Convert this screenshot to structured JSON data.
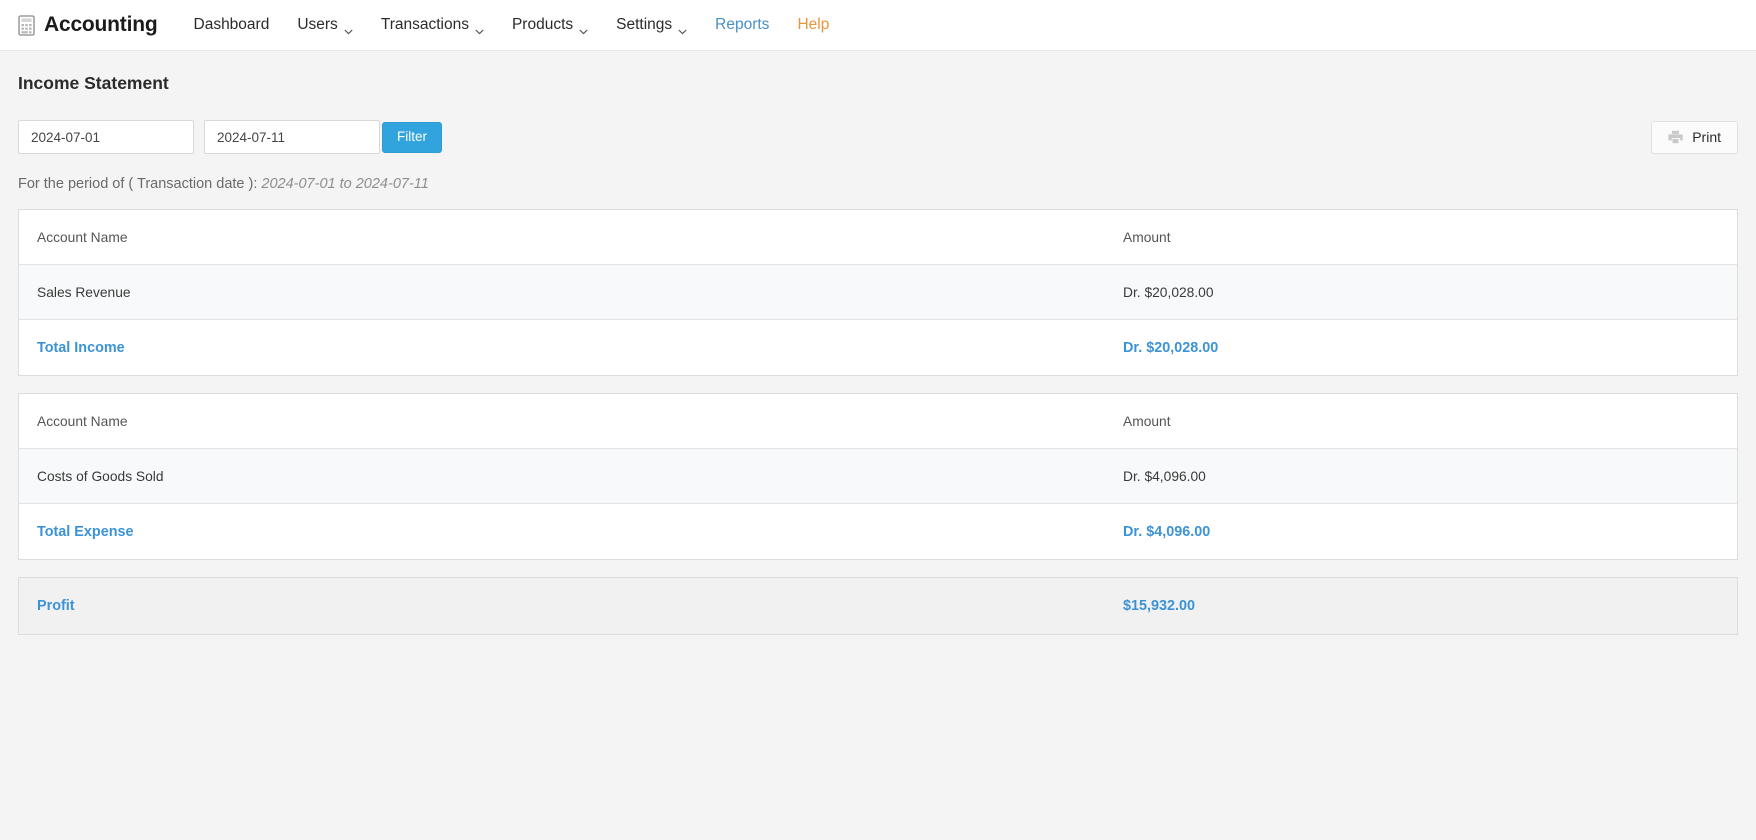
{
  "navbar": {
    "brand": {
      "icon": "calculator-icon",
      "label": "Accounting"
    },
    "items": [
      {
        "label": "Dashboard",
        "caret": false,
        "style": "default"
      },
      {
        "label": "Users",
        "caret": true,
        "style": "default"
      },
      {
        "label": "Transactions",
        "caret": true,
        "style": "default"
      },
      {
        "label": "Products",
        "caret": true,
        "style": "default"
      },
      {
        "label": "Settings",
        "caret": true,
        "style": "default"
      },
      {
        "label": "Reports",
        "caret": false,
        "style": "blue"
      },
      {
        "label": "Help",
        "caret": false,
        "style": "orange"
      }
    ]
  },
  "page": {
    "title": "Income Statement"
  },
  "filters": {
    "start_date": "2024-07-01",
    "start_placeholder": "2024-07-01",
    "end_date": "2024-07-11",
    "end_placeholder": "2024-07-11",
    "filter_label": "Filter",
    "print_label": "Print",
    "print_icon": "printer-icon"
  },
  "period": {
    "prefix": "For the period of ( Transaction date ):",
    "range": "2024-07-01 to 2024-07-11"
  },
  "income_table": {
    "headers": {
      "name": "Account Name",
      "amount": "Amount"
    },
    "rows": [
      {
        "name": "Sales Revenue",
        "amount": "Dr. $20,028.00"
      }
    ],
    "total": {
      "name": "Total Income",
      "amount": "Dr. $20,028.00"
    }
  },
  "expense_table": {
    "headers": {
      "name": "Account Name",
      "amount": "Amount"
    },
    "rows": [
      {
        "name": "Costs of Goods Sold",
        "amount": "Dr. $4,096.00"
      }
    ],
    "total": {
      "name": "Total Expense",
      "amount": "Dr. $4,096.00"
    }
  },
  "profit": {
    "label": "Profit",
    "amount": "$15,932.00"
  },
  "colors": {
    "accent_blue": "#31a3dd",
    "link_blue": "#4a90c4",
    "total_blue": "#3c93d6",
    "help_orange": "#e8963c",
    "page_bg": "#f4f4f4",
    "card_bg": "#ffffff",
    "striped_bg": "#f8f9fa",
    "profit_bg": "#f1f1f1"
  }
}
